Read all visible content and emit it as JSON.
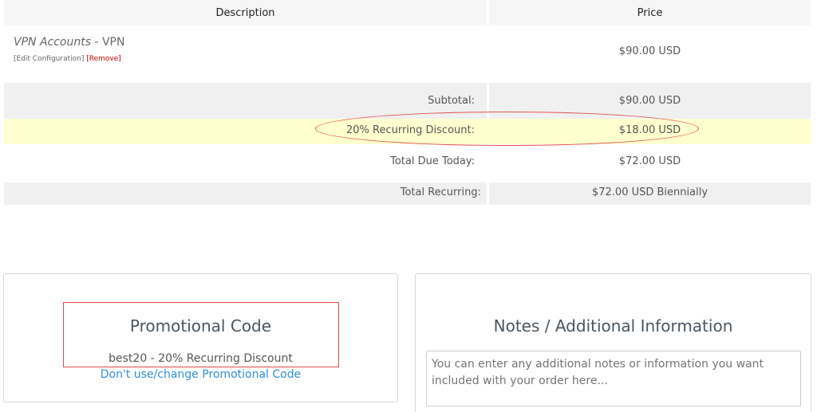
{
  "table": {
    "header": {
      "description": "Description",
      "price": "Price"
    },
    "item": {
      "category": "VPN Accounts",
      "separator": " - ",
      "name": "VPN",
      "edit_link": "[Edit Configuration]",
      "remove_link": "[Remove]",
      "price": "$90.00 USD"
    },
    "subtotal": {
      "label": "Subtotal:",
      "value": "$90.00 USD"
    },
    "discount": {
      "label": "20% Recurring Discount:",
      "value": "$18.00 USD"
    },
    "total_due": {
      "label": "Total Due Today:",
      "value": "$72.00 USD"
    },
    "total_recurring": {
      "label": "Total Recurring:",
      "value": "$72.00 USD Biennially"
    }
  },
  "promo": {
    "title": "Promotional Code",
    "code": "best20 - 20% Recurring Discount",
    "change_link": "Don't use/change Promotional Code"
  },
  "notes": {
    "title": "Notes / Additional Information",
    "placeholder": "You can enter any additional notes or information you want included with your order here..."
  },
  "colors": {
    "discount_highlight": "#ffffd0",
    "annotation_red": "#e04a4a",
    "link_blue": "#2e8fd4",
    "remove_red": "#cc0000"
  }
}
